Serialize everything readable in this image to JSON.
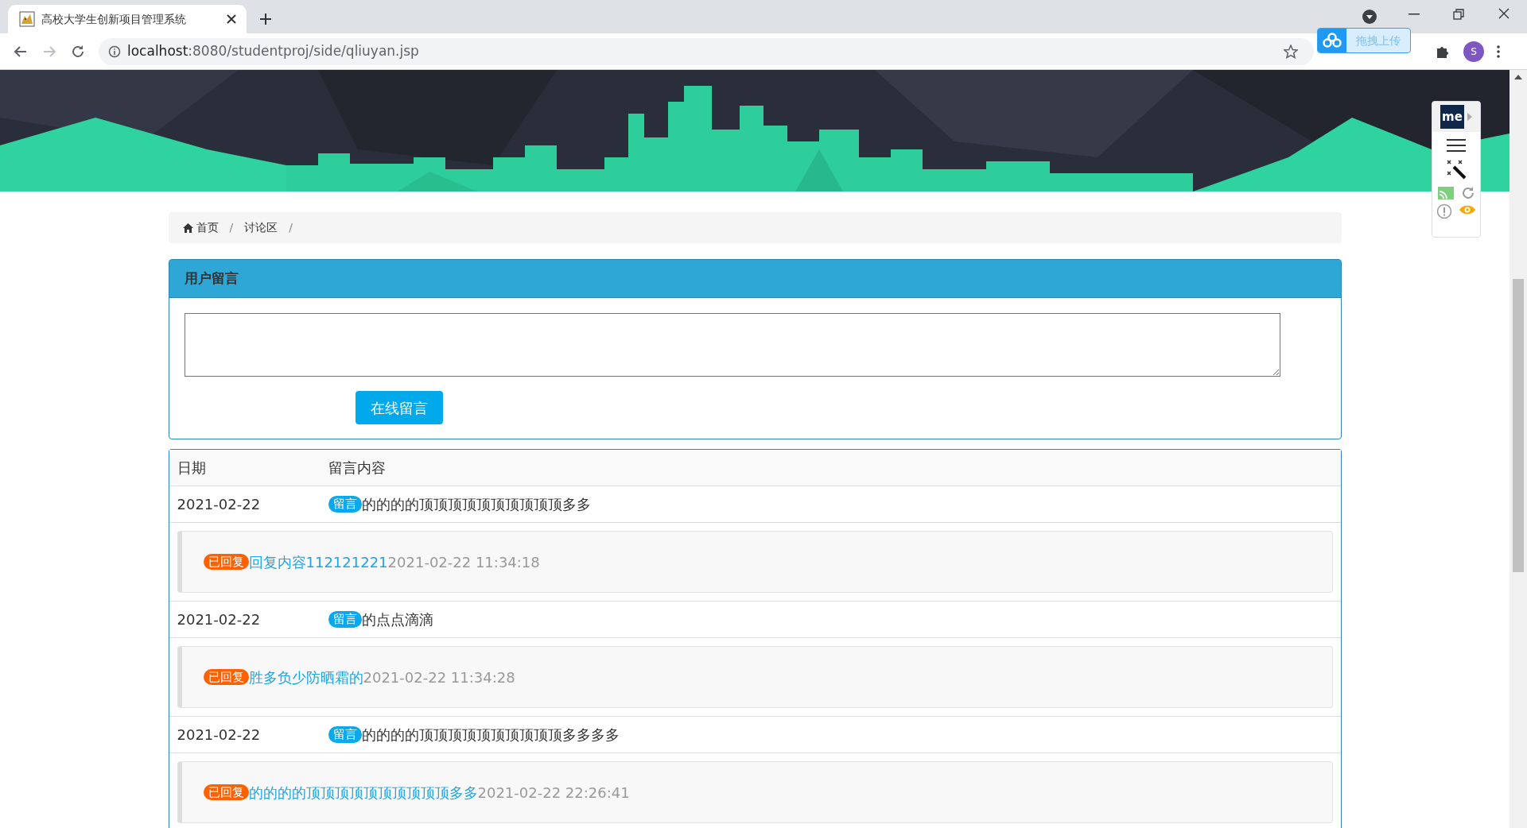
{
  "browser": {
    "tab_title": "高校大学生创新项目管理系统",
    "url_host": "localhost",
    "url_path": ":8080/studentproj/side/qliuyan.jsp",
    "upload_button": "拖拽上传",
    "profile_initial": "S"
  },
  "extension_panel": {
    "logo": "me"
  },
  "breadcrumb": [
    {
      "label": "首页",
      "kind": "home",
      "separator": "/"
    },
    {
      "label": "讨论区",
      "kind": "plain",
      "separator": "/"
    }
  ],
  "message_form": {
    "title": "用户留言",
    "submit": "在线留言"
  },
  "table": {
    "columns": [
      "日期",
      "留言内容"
    ],
    "rows": [
      {
        "date": "2021-02-22",
        "tag": "留言",
        "content": "的的的的顶顶顶顶顶顶顶顶顶顶多多",
        "reply": {
          "tag": "已回复",
          "content": "回复内容112121221",
          "time": "2021-02-22 11:34:18"
        }
      },
      {
        "date": "2021-02-22",
        "tag": "留言",
        "content": "的点点滴滴",
        "reply": {
          "tag": "已回复",
          "content": "胜多负少防晒霜的",
          "time": "2021-02-22 11:34:28"
        }
      },
      {
        "date": "2021-02-22",
        "tag": "留言",
        "content": "的的的的顶顶顶顶顶顶顶顶顶顶多多多多",
        "reply": {
          "tag": "已回复",
          "content": "的的的的顶顶顶顶顶顶顶顶顶顶多多",
          "time": "2021-02-22 22:26:41"
        }
      }
    ]
  }
}
